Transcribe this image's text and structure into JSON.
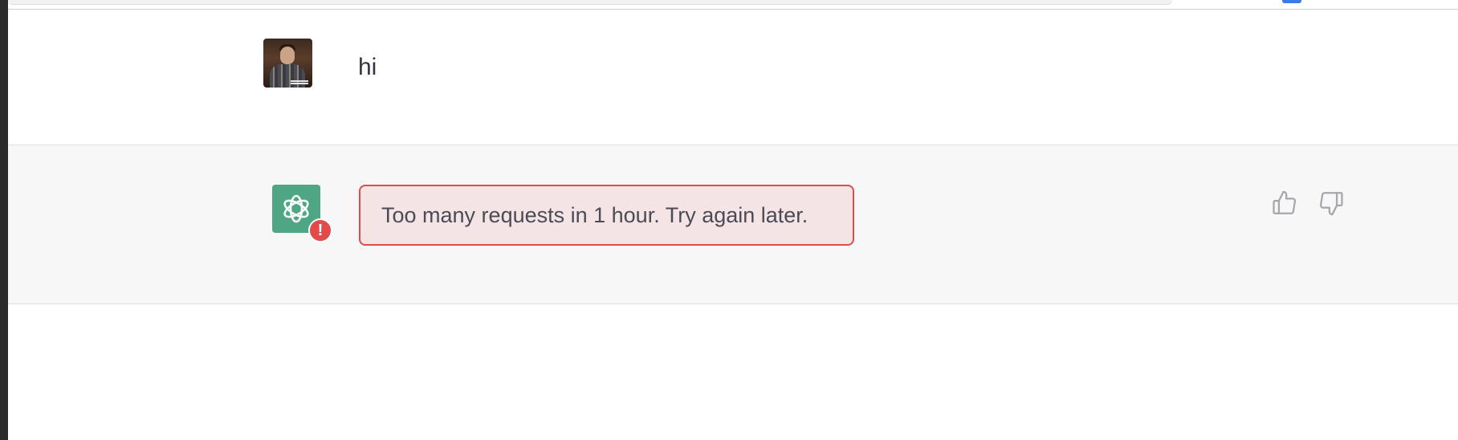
{
  "conversation": {
    "user_message": {
      "avatar": "user-photo-avatar",
      "text": "hi"
    },
    "assistant_message": {
      "avatar": "openai-logo-icon",
      "error_badge": "!",
      "error_text": "Too many requests in 1 hour. Try again later.",
      "feedback": {
        "thumbs_up_icon": "thumbs-up-icon",
        "thumbs_down_icon": "thumbs-down-icon"
      }
    }
  },
  "colors": {
    "assistant_bg": "#f7f7f8",
    "gpt_avatar": "#4ea685",
    "error_border": "#e04c4c",
    "error_bg": "#f5e4e6",
    "error_badge": "#e34a4a"
  }
}
